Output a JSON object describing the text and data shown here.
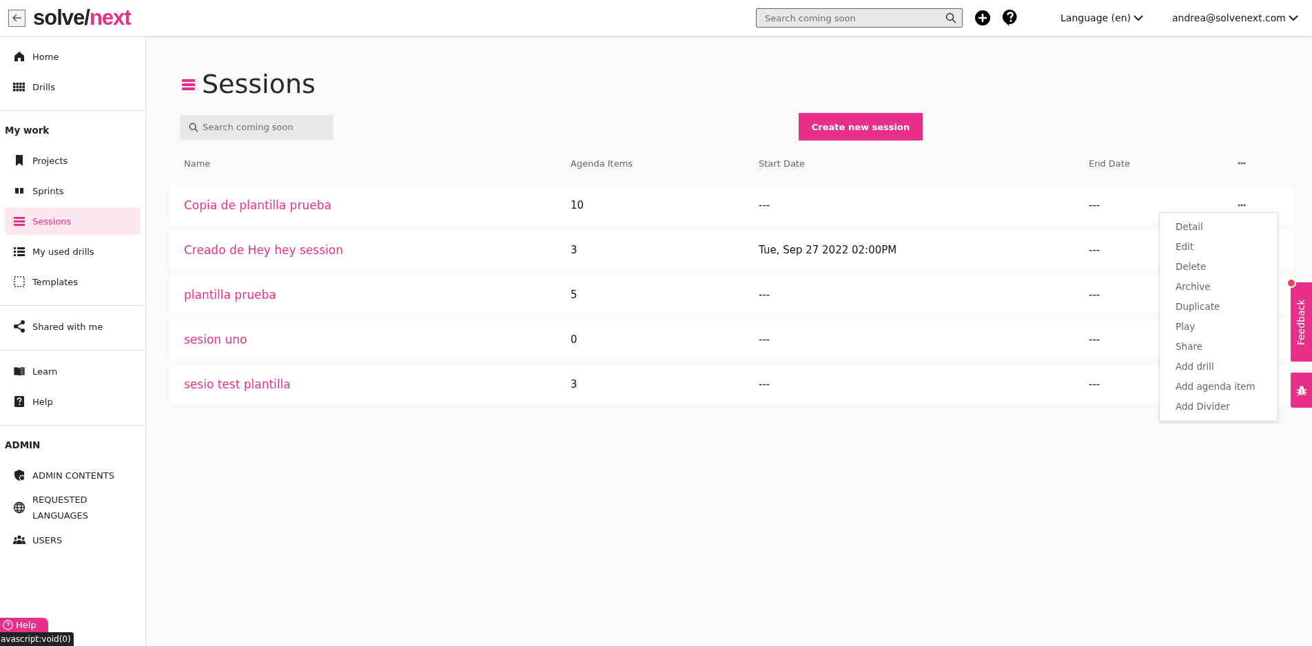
{
  "header": {
    "logo": {
      "main": "solve/",
      "accent": "next"
    },
    "search": {
      "placeholder": "Search coming soon"
    },
    "language": "Language (en)",
    "user": "andrea@solvenext.com"
  },
  "sidebar": {
    "groups": [
      {
        "items": [
          {
            "label": "Home",
            "selected": false
          },
          {
            "label": "Drills",
            "selected": false
          }
        ]
      },
      {
        "heading": "My work",
        "items": [
          {
            "label": "Projects",
            "selected": false
          },
          {
            "label": "Sprints",
            "selected": false
          },
          {
            "label": "Sessions",
            "selected": true
          },
          {
            "label": "My used drills",
            "selected": false
          },
          {
            "label": "Templates",
            "selected": false
          }
        ]
      },
      {
        "items": [
          {
            "label": "Shared with me",
            "selected": false
          }
        ]
      },
      {
        "items": [
          {
            "label": "Learn",
            "selected": false
          },
          {
            "label": "Help",
            "selected": false
          }
        ]
      },
      {
        "heading": "ADMIN",
        "items": [
          {
            "label": "ADMIN CONTENTS",
            "selected": false
          },
          {
            "label": "REQUESTED LANGUAGES",
            "selected": false
          },
          {
            "label": "USERS",
            "selected": false
          }
        ]
      }
    ]
  },
  "page": {
    "title": "Sessions",
    "search": {
      "placeholder": "Search coming soon"
    },
    "create_button": "Create new session"
  },
  "table": {
    "columns": [
      "Name",
      "Agenda Items",
      "Start Date",
      "End Date"
    ],
    "rows": [
      {
        "name": "Copia de plantilla prueba",
        "agenda_items": "10",
        "start_date": "---",
        "end_date": "---"
      },
      {
        "name": "Creado de Hey hey session",
        "agenda_items": "3",
        "start_date": "Tue, Sep 27 2022 02:00PM",
        "end_date": "---"
      },
      {
        "name": "plantilla prueba",
        "agenda_items": "5",
        "start_date": "---",
        "end_date": "---"
      },
      {
        "name": "sesion uno",
        "agenda_items": "0",
        "start_date": "---",
        "end_date": "---"
      },
      {
        "name": "sesio test plantilla",
        "agenda_items": "3",
        "start_date": "---",
        "end_date": "---"
      }
    ],
    "row_menu": [
      "Detail",
      "Edit",
      "Delete",
      "Archive",
      "Duplicate",
      "Play",
      "Share",
      "Add drill",
      "Add agenda item",
      "Add Divider"
    ]
  },
  "feedback_tab": "Feedback",
  "help_button": "Help",
  "status_text": "avascript:void(0)"
}
